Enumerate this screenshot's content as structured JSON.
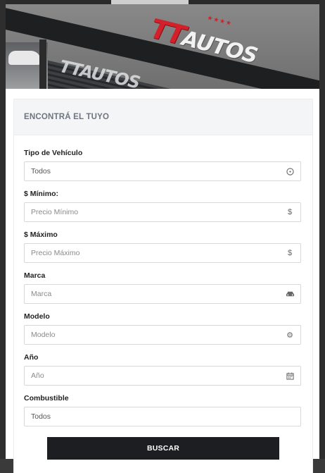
{
  "banner": {
    "logo_primary": "TT",
    "logo_secondary": "AUTOS",
    "wall_sign": "TTAUTOS"
  },
  "form": {
    "title": "ENCONTRÁ EL TUYO",
    "fields": [
      {
        "label": "Tipo de Vehículo",
        "value": "Todos",
        "placeholder": "",
        "icon": "clock-icon"
      },
      {
        "label": "$ Mínimo:",
        "value": "",
        "placeholder": "Precio Mínimo",
        "icon": "dollar-icon"
      },
      {
        "label": "$ Máximo",
        "value": "",
        "placeholder": "Precio Máximo",
        "icon": "dollar-icon"
      },
      {
        "label": "Marca",
        "value": "",
        "placeholder": "Marca",
        "icon": "car-icon"
      },
      {
        "label": "Modelo",
        "value": "",
        "placeholder": "Modelo",
        "icon": "gear-icon"
      },
      {
        "label": "Año",
        "value": "",
        "placeholder": "Año",
        "icon": "calendar-icon"
      },
      {
        "label": "Combustible",
        "value": "Todos",
        "placeholder": "",
        "icon": ""
      }
    ],
    "submit_label": "BUSCAR"
  },
  "colors": {
    "button_bg": "#1c1e22",
    "header_bg": "#f4f5f7",
    "brand_red": "#d3202a"
  }
}
